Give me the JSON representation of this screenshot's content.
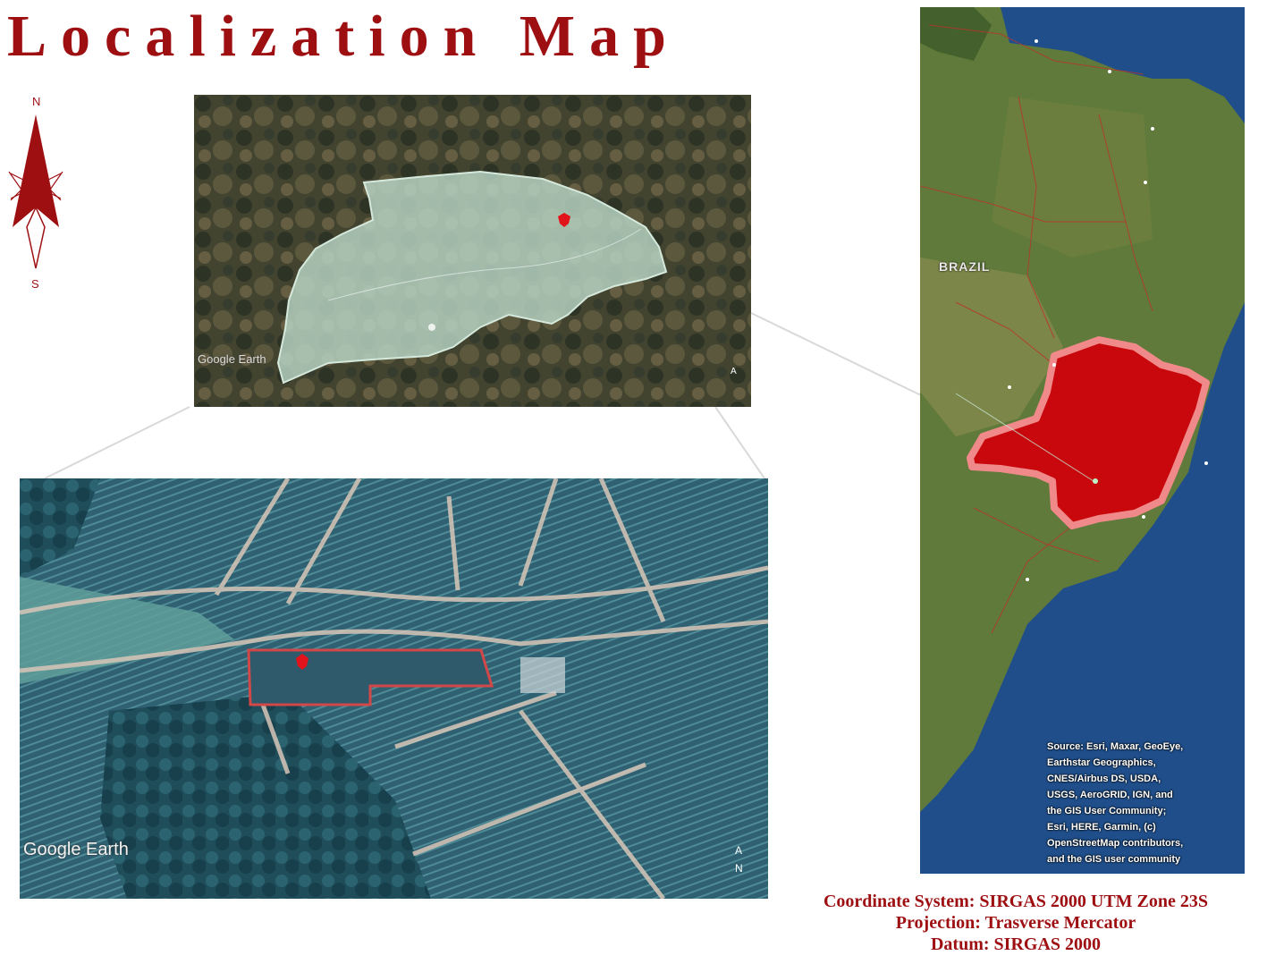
{
  "title": "Localization Map",
  "north_arrow": {
    "north_label": "N",
    "south_label": "S"
  },
  "region_view": {
    "watermark": "Google Earth"
  },
  "farm_view": {
    "watermark": "Google Earth"
  },
  "brazil_map": {
    "country_label": "BRAZIL",
    "source_lines": [
      "Source: Esri, Maxar, GeoEye,",
      "Earthstar Geographics,",
      "CNES/Airbus DS, USDA,",
      "USGS, AeroGRID, IGN, and",
      "the GIS User Community;",
      "Esri, HERE, Garmin, (c)",
      "OpenStreetMap contributors,",
      "and the GIS user community"
    ]
  },
  "coordinate_info": {
    "system": "Coordinate System: SIRGAS 2000 UTM Zone 23S",
    "projection": "Projection: Trasverse Mercator",
    "datum": "Datum: SIRGAS 2000"
  },
  "colors": {
    "accent": "#9e0f12",
    "state_fill": "#c8080c",
    "state_halo": "#f08a8a",
    "ocean": "#1f4e8a",
    "land": "#5f7a3a",
    "farm_fill": "#3f7a87",
    "region_overlay": "#b9d6c6"
  }
}
